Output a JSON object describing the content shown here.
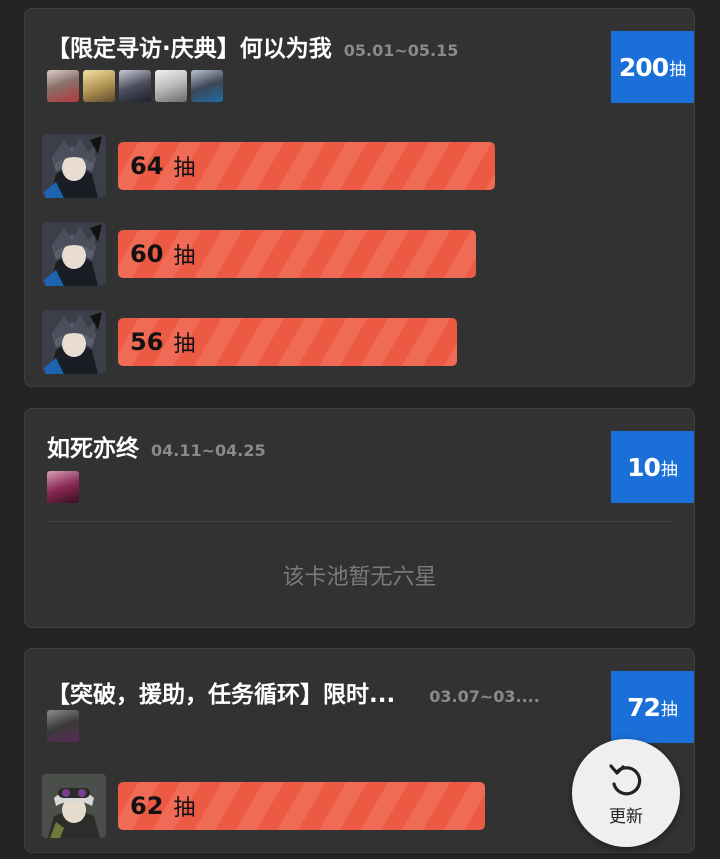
{
  "pools": [
    {
      "title": "【限定寻访·庆典】何以为我",
      "dates": "05.01~05.15",
      "badge": {
        "count": "200",
        "unit": "抽"
      },
      "thumbs": [
        "operator-avatar-1",
        "operator-avatar-2",
        "operator-avatar-3",
        "operator-avatar-4",
        "operator-avatar-5"
      ],
      "rows": [
        {
          "count": "64",
          "unit": "抽"
        },
        {
          "count": "60",
          "unit": "抽"
        },
        {
          "count": "56",
          "unit": "抽"
        }
      ]
    },
    {
      "title": "如死亦终",
      "dates": "04.11~04.25",
      "badge": {
        "count": "10",
        "unit": "抽"
      },
      "thumbs": [
        "operator-avatar"
      ],
      "empty_text": "该卡池暂无六星"
    },
    {
      "title": "【突破，援助，任务循环】限时...",
      "dates": "03.07~03....",
      "badge": {
        "count": "72",
        "unit": "抽"
      },
      "thumbs": [
        "operator-avatar"
      ],
      "rows": [
        {
          "count": "62",
          "unit": "抽"
        }
      ]
    }
  ],
  "refresh": {
    "label": "更新",
    "icon": "refresh-icon"
  },
  "colors": {
    "background": "#232323",
    "card": "#323232",
    "badge": "#1a6fd8",
    "bar": "#ec5a44"
  }
}
